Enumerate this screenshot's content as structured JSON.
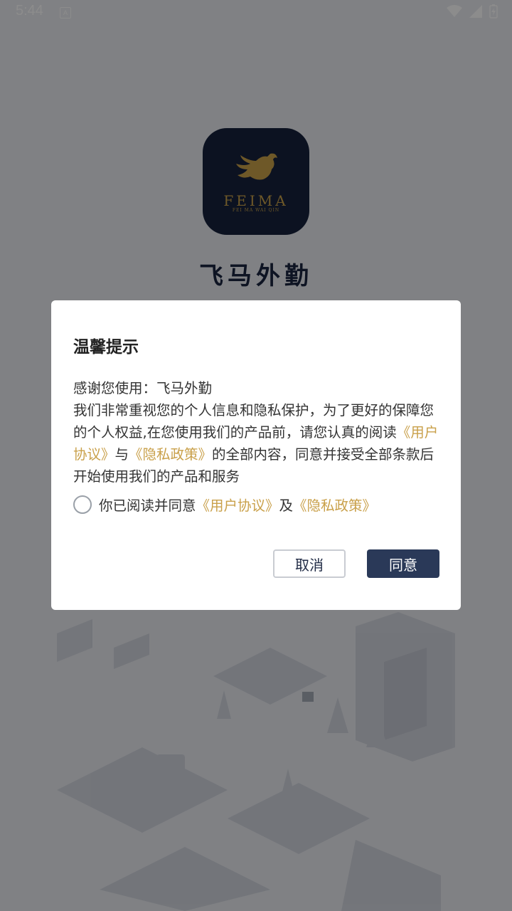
{
  "status_bar": {
    "time": "5:44",
    "notification_icon": "a-icon",
    "wifi_icon": "wifi-icon",
    "signal_icon": "signal-icon",
    "battery_icon": "battery-charging-icon"
  },
  "app": {
    "logo_brand": "FEIMA",
    "logo_sub": "FEI MA WAI QIN",
    "name": "飞马外勤"
  },
  "dialog": {
    "title": "温馨提示",
    "line1": "感谢您使用：飞马外勤",
    "line2_part1": " 我们非常重视您的个人信息和隐私保护，为了更好的保障您的个人权益,在您使用我们的产品前，请您认真的阅读",
    "user_agreement_link": "《用户协议》",
    "line2_and": "与",
    "privacy_link": "《隐私政策》",
    "line2_part2": "的全部内容，同意并接受全部条款后开始使用我们的产品和服务",
    "agree_prefix": "你已阅读并同意",
    "agree_user_link": "《用户协议》",
    "agree_and": "及",
    "agree_privacy_link": "《隐私政策》",
    "cancel_label": "取消",
    "agree_label": "同意"
  },
  "colors": {
    "link": "#c9a04a",
    "primary_button": "#2a3958",
    "logo_bg": "#16223d"
  }
}
